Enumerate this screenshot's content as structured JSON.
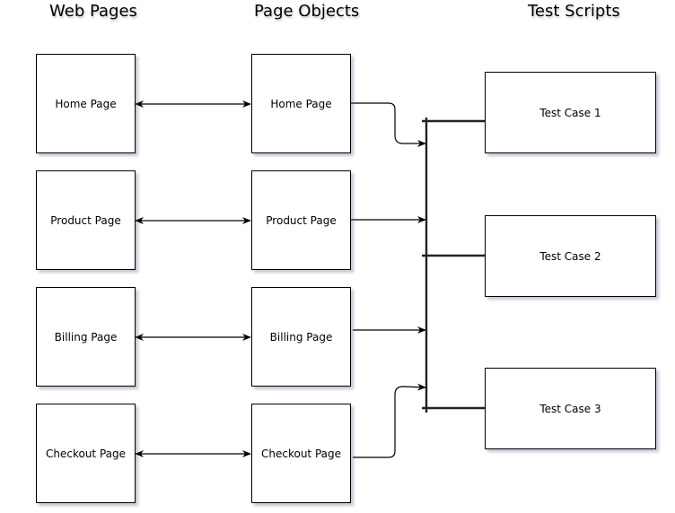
{
  "headings": {
    "web_pages": "Web Pages",
    "page_objects": "Page Objects",
    "test_scripts": "Test Scripts"
  },
  "web_pages": [
    "Home Page",
    "Product Page",
    "Billing Page",
    "Checkout Page"
  ],
  "page_objects": [
    "Home Page",
    "Product Page",
    "Billing Page",
    "Checkout Page"
  ],
  "test_cases": [
    "Test Case 1",
    "Test Case 2",
    "Test Case 3"
  ]
}
